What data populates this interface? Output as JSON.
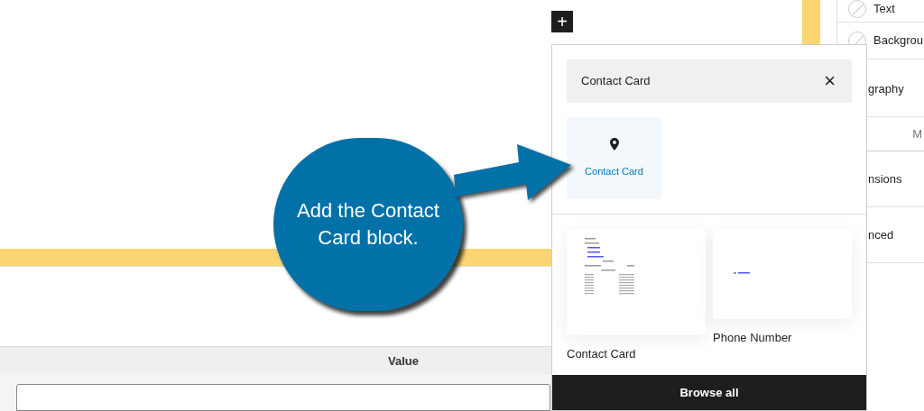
{
  "toolbar": {
    "add_button": "+"
  },
  "sidebar": {
    "rows": [
      {
        "kind": "color",
        "label": "Text"
      },
      {
        "kind": "color",
        "label": "Backgrou"
      },
      {
        "kind": "section",
        "label": "graphy"
      },
      {
        "kind": "tabs",
        "label": "M"
      },
      {
        "kind": "section",
        "label": "nsions"
      },
      {
        "kind": "section",
        "label": "nced"
      }
    ]
  },
  "inserter": {
    "search": {
      "value": "Contact Card",
      "clear": "×"
    },
    "results": [
      {
        "label": "Contact Card",
        "selected": true
      }
    ],
    "patterns": [
      {
        "label": "Contact Card",
        "kind": "card"
      },
      {
        "label": "Phone Number",
        "kind": "phone"
      }
    ],
    "browse_all": "Browse all"
  },
  "table": {
    "columns": [
      "Value"
    ]
  },
  "callout": {
    "text": "Add the Contact Card block."
  }
}
